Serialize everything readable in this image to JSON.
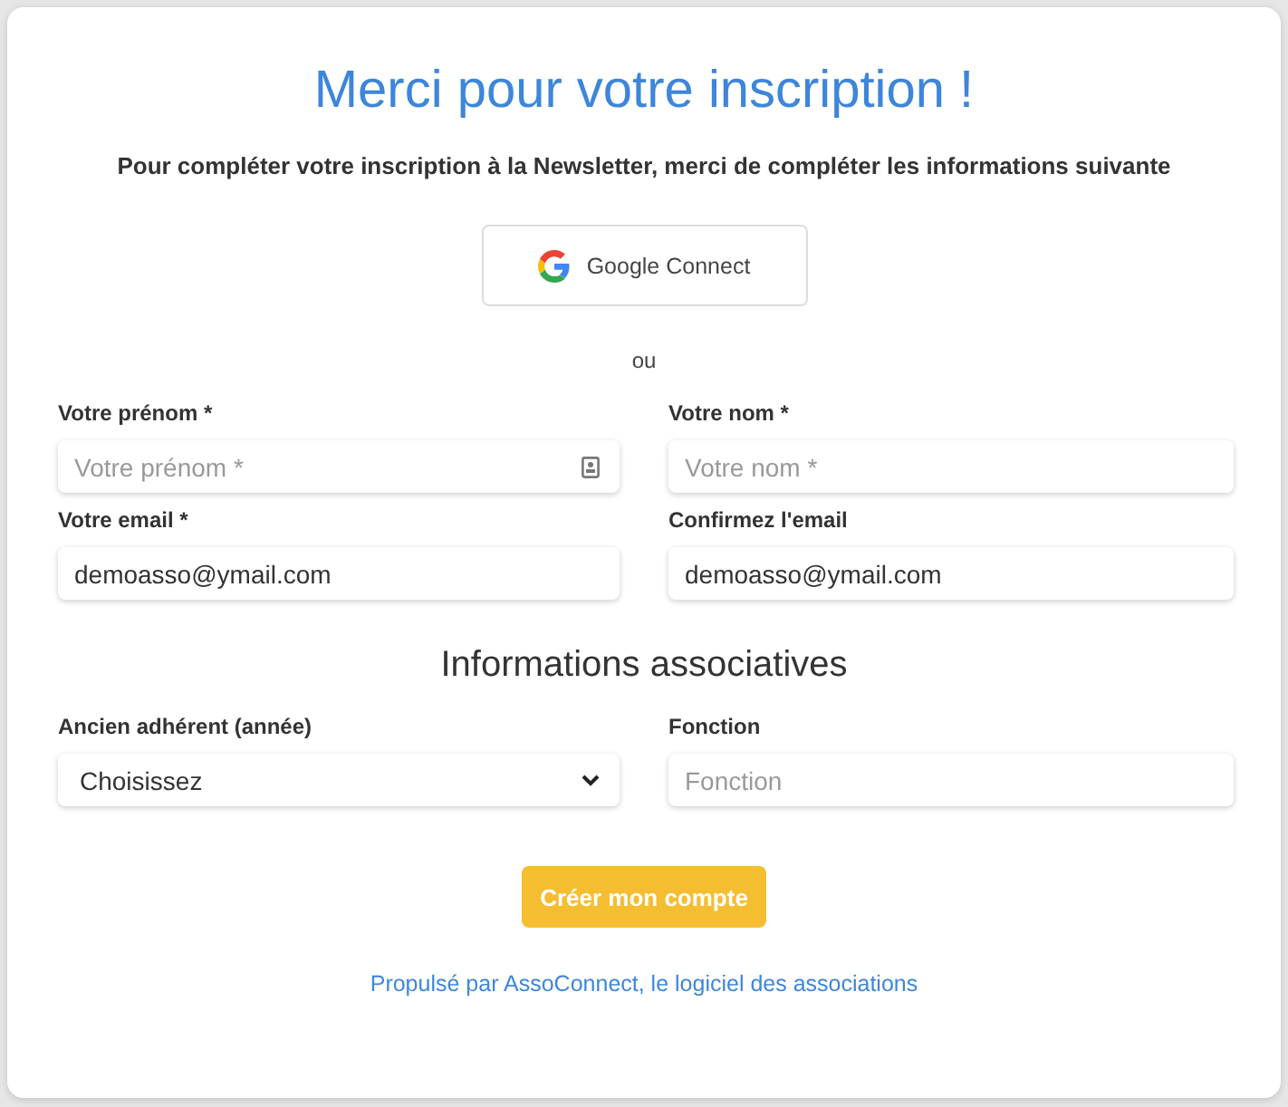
{
  "title": "Merci pour votre inscription !",
  "intro": "Pour compléter votre inscription à la Newsletter, merci de compléter les informations suivante",
  "google_button": "Google Connect",
  "separator": "ou",
  "identity_fields": [
    {
      "label": "Votre prénom *",
      "kind": "contact",
      "placeholder": "Votre prénom *"
    },
    {
      "label": "Votre nom *",
      "kind": "text",
      "placeholder": "Votre nom *"
    },
    {
      "label": "Votre email *",
      "kind": "text",
      "value": "demoasso@ymail.com"
    },
    {
      "label": "Confirmez l'email",
      "kind": "text",
      "value": "demoasso@ymail.com"
    }
  ],
  "section_title": "Informations associatives",
  "association_fields": [
    {
      "label": "Ancien adhérent (année)",
      "kind": "select",
      "value": "Choisissez"
    },
    {
      "label": "Fonction",
      "kind": "text",
      "placeholder": "Fonction"
    }
  ],
  "submit_button": "Créer mon compte",
  "footer_link": "Propulsé par AssoConnect, le logiciel des associations"
}
